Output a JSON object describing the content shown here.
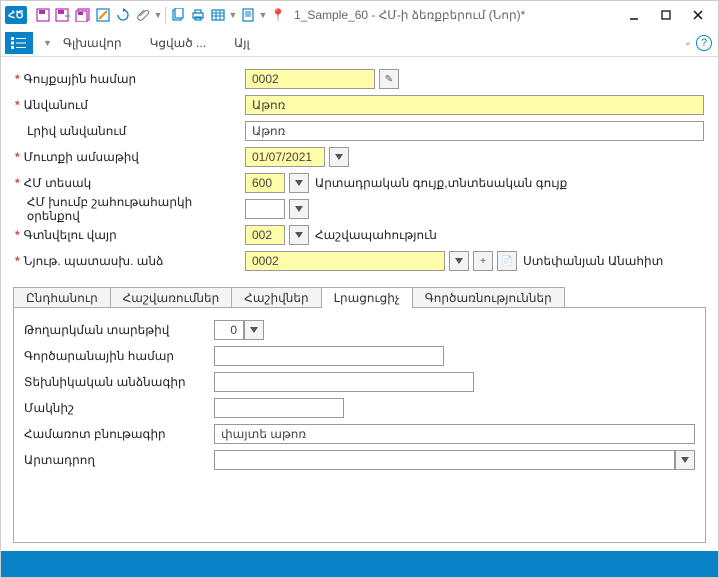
{
  "window": {
    "title": "1_Sample_60 - ՀՄ-ի ձեռքբերում (Նոր)*"
  },
  "menu": {
    "main": "Գլխավոր",
    "kcvats": "Կցված ...",
    "ayl": "Այլ"
  },
  "fields": {
    "inventory_num_label": "Գույքային համար",
    "inventory_num": "0002",
    "name_label": "Անվանում",
    "name": "Աթոռ",
    "full_name_label": "Լրիվ անվանում",
    "full_name": "Աթոռ",
    "entry_date_label": "Մուտքի ամսաթիվ",
    "entry_date": "01/07/2021",
    "hm_type_label": "ՀՄ տեսակ",
    "hm_type_code": "600",
    "hm_type_text": "Արտադրական գույք,տնտեսական գույք",
    "hm_group_label": "ՀՄ խումբ շահութահարկի օրենքով",
    "location_label": "Գտնվելու վայր",
    "location_code": "002",
    "location_text": "Հաշվապահություն",
    "responsible_label": "Նյութ. պատասխ. անձ",
    "responsible_code": "0002",
    "responsible_text": "Ստեփանյան Անահիտ"
  },
  "tabs": {
    "t1": "Ընդհանուր",
    "t2": "Հաշվառումներ",
    "t3": "Հաշիվներ",
    "t4": "Լրացուցիչ",
    "t5": "Գործառնություններ"
  },
  "extra": {
    "release_year_label": "Թողարկման տարեթիվ",
    "release_year": "0",
    "factory_num_label": "Գործարանային համար",
    "tech_passport_label": "Տեխնիկական անձնագիր",
    "brand_label": "Մակնիշ",
    "short_desc_label": "Համառոտ բնութագիր",
    "short_desc": "փայտե աթոռ",
    "manufacturer_label": "Արտադրող"
  }
}
